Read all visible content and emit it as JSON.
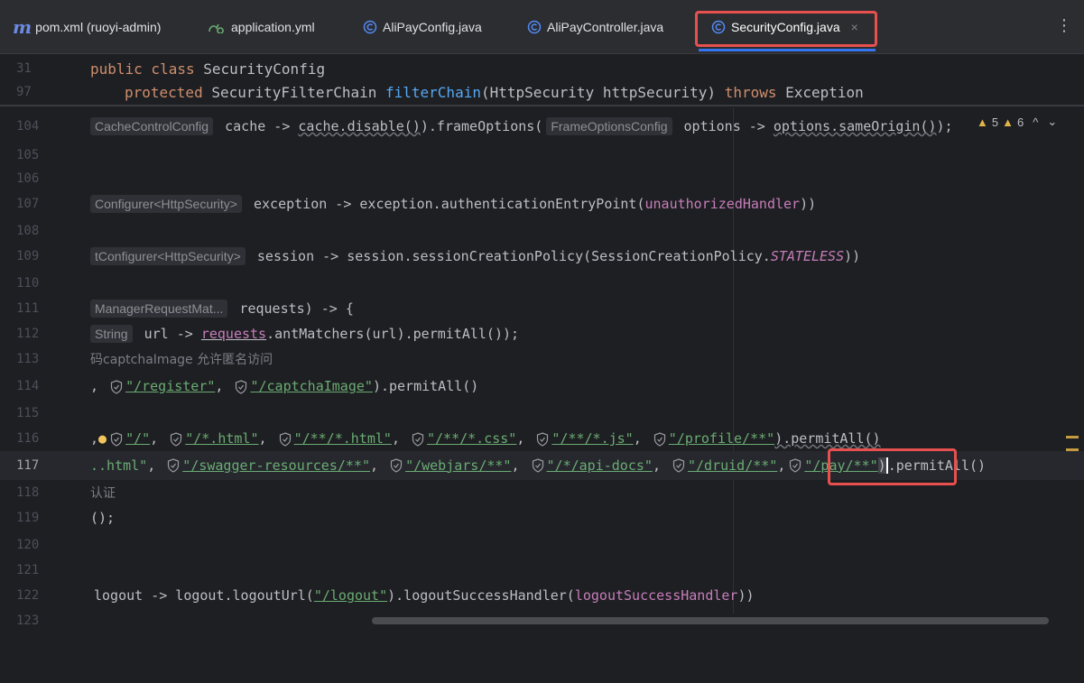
{
  "tabs": [
    {
      "label": "pom.xml (ruoyi-admin)",
      "icon": "maven-icon"
    },
    {
      "label": "application.yml",
      "icon": "yaml-icon"
    },
    {
      "label": "AliPayConfig.java",
      "icon": "java-class-icon"
    },
    {
      "label": "AliPayController.java",
      "icon": "java-class-icon"
    },
    {
      "label": "SecurityConfig.java",
      "icon": "java-class-icon",
      "active": true
    }
  ],
  "tab_close": "×",
  "more": "⋮",
  "warnings": {
    "weak": "5",
    "strong": "6"
  },
  "colors": {
    "accent": "#3574f0",
    "highlight": "#e7504f",
    "keyword": "#cf8e6d",
    "string": "#6aab73",
    "function": "#56a8f5",
    "field": "#c77dbb"
  },
  "lines": {
    "l31": {
      "num": "31",
      "kw": "public class",
      "name": " SecurityConfig"
    },
    "l97": {
      "num": "97",
      "kw1": "protected",
      "type": " SecurityFilterChain ",
      "fn": "filterChain",
      "args": "(HttpSecurity httpSecurity) ",
      "kw2": "throws",
      "exc": " Exception"
    },
    "l104": {
      "num": "104",
      "hint1": "CacheControlConfig",
      "a": " cache -> ",
      "b": "cache.disable()",
      "c": ").frameOptions(",
      "hint2": "FrameOptionsConfig",
      "d": " options -> ",
      "e": "options.sameOrigin()",
      "f": ");"
    },
    "l105": {
      "num": "105"
    },
    "l106": {
      "num": "106"
    },
    "l107": {
      "num": "107",
      "hint": "Configurer<HttpSecurity>",
      "a": " exception -> exception.authenticationEntryPoint(",
      "field": "unauthorizedHandler",
      "b": "))"
    },
    "l108": {
      "num": "108"
    },
    "l109": {
      "num": "109",
      "hint": "tConfigurer<HttpSecurity>",
      "a": " session -> session.sessionCreationPolicy(SessionCreationPolicy.",
      "const": "STATELESS",
      "b": "))"
    },
    "l110": {
      "num": "110"
    },
    "l111": {
      "num": "111",
      "hint": "ManagerRequestMat...",
      "a": " requests) -> {"
    },
    "l112": {
      "num": "112",
      "hint": "String",
      "a": " url -> ",
      "field": "requests",
      "b": ".antMatchers(url).permitAll());"
    },
    "l113": {
      "num": "113",
      "comment": "码captchaImage 允许匿名访问"
    },
    "l114": {
      "num": "114",
      "a": ", ",
      "s1": "\"/register\"",
      "b": ", ",
      "s2": "\"/captchaImage\"",
      "c": ").permitAll()"
    },
    "l115": {
      "num": "115"
    },
    "l116": {
      "num": "116",
      "a": ",",
      "s1": "\"/\"",
      "s2": "\"/*.html\"",
      "s3": "\"/**/*.html\"",
      "s4": "\"/**/*.css\"",
      "s5": "\"/**/*.js\"",
      "s6": "\"/profile/**\"",
      "c": ").permitAll()",
      "sep": ", "
    },
    "l117": {
      "num": "117",
      "a": "..html\"",
      "s1": "\"/swagger-resources/**\"",
      "s2": "\"/webjars/**\"",
      "s3": "\"/*/api-docs\"",
      "s4": "\"/druid/**\"",
      "s5": "\"/pay/**\"",
      "p": ")",
      "c": ".permitAll()",
      "sep": ", ",
      "comma": ","
    },
    "l118": {
      "num": "118",
      "comment": "认证"
    },
    "l119": {
      "num": "119",
      "a": "();"
    },
    "l120": {
      "num": "120"
    },
    "l121": {
      "num": "121"
    },
    "l122": {
      "num": "122",
      "a": "logout -> logout.logoutUrl(",
      "s1": "\"/logout\"",
      "b": ").logoutSuccessHandler(",
      "field": "logoutSuccessHandler",
      "c": "))"
    },
    "l123": {
      "num": "123"
    }
  }
}
